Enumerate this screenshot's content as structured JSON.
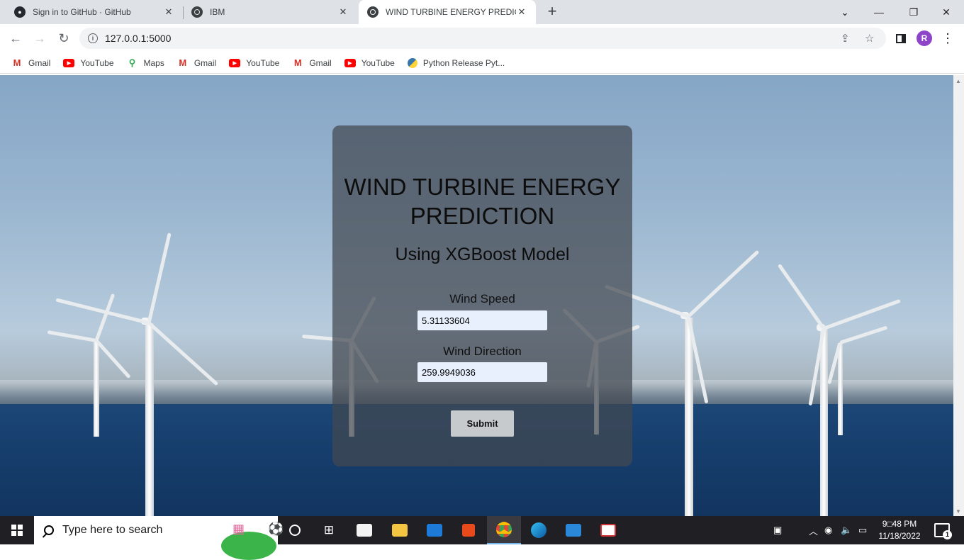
{
  "browser": {
    "tabs": [
      {
        "title": "Sign in to GitHub · GitHub",
        "icon": "github-icon"
      },
      {
        "title": "IBM",
        "icon": "globe-icon"
      },
      {
        "title": "WIND TURBINE ENERGY PREDICTI",
        "icon": "globe-icon",
        "active": true
      }
    ],
    "tab_close": "✕",
    "new_tab": "+",
    "window_controls": {
      "dropdown": "⌄",
      "minimize": "—",
      "restore": "❐",
      "close": "✕"
    },
    "nav": {
      "back": "←",
      "forward": "→",
      "reload": "↻"
    },
    "url": "127.0.0.1:5000",
    "profile_initial": "R",
    "bookmarks": [
      {
        "label": "Gmail",
        "icon": "gmail-icon"
      },
      {
        "label": "YouTube",
        "icon": "youtube-icon"
      },
      {
        "label": "Maps",
        "icon": "maps-icon"
      },
      {
        "label": "Gmail",
        "icon": "gmail-icon"
      },
      {
        "label": "YouTube",
        "icon": "youtube-icon"
      },
      {
        "label": "Gmail",
        "icon": "gmail-icon"
      },
      {
        "label": "YouTube",
        "icon": "youtube-icon"
      },
      {
        "label": "Python Release Pyt...",
        "icon": "python-icon"
      }
    ]
  },
  "page": {
    "title": "WIND TURBINE ENERGY PREDICTION",
    "subtitle": "Using XGBoost Model",
    "wind_speed_label": "Wind Speed",
    "wind_speed_value": "5.31133604",
    "wind_direction_label": "Wind Direction",
    "wind_direction_value": "259.9949036",
    "submit_label": "Submit"
  },
  "taskbar": {
    "search_placeholder": "Type here to search",
    "time": "9□48 PM",
    "date": "11/18/2022",
    "notification_count": "1"
  },
  "colors": {
    "card_bg": "#424850",
    "input_bg": "#e8f0fe",
    "submit_bg": "#c7cacd",
    "taskbar_bg": "#1f1f24",
    "profile": "#8e44c9"
  }
}
